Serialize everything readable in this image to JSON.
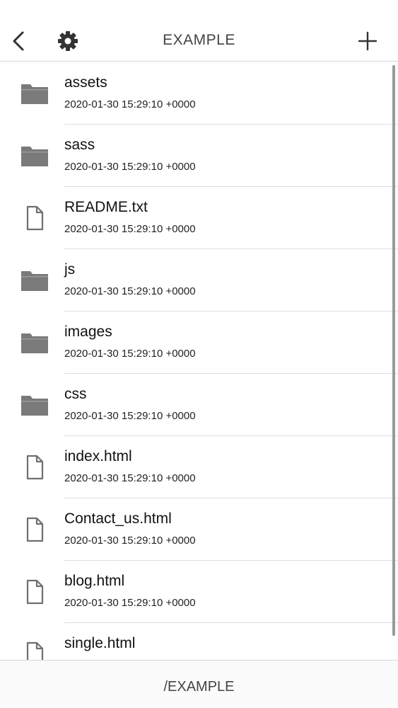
{
  "header": {
    "title": "EXAMPLE",
    "back_icon": "chevron-left-icon",
    "settings_icon": "gear-icon",
    "add_icon": "plus-icon"
  },
  "files": [
    {
      "name": "assets",
      "date": "2020-01-30 15:29:10 +0000",
      "kind": "folder"
    },
    {
      "name": "sass",
      "date": "2020-01-30 15:29:10 +0000",
      "kind": "folder"
    },
    {
      "name": "README.txt",
      "date": "2020-01-30 15:29:10 +0000",
      "kind": "file"
    },
    {
      "name": "js",
      "date": "2020-01-30 15:29:10 +0000",
      "kind": "folder"
    },
    {
      "name": "images",
      "date": "2020-01-30 15:29:10 +0000",
      "kind": "folder"
    },
    {
      "name": "css",
      "date": "2020-01-30 15:29:10 +0000",
      "kind": "folder"
    },
    {
      "name": "index.html",
      "date": "2020-01-30 15:29:10 +0000",
      "kind": "file"
    },
    {
      "name": "Contact_us.html",
      "date": "2020-01-30 15:29:10 +0000",
      "kind": "file"
    },
    {
      "name": "blog.html",
      "date": "2020-01-30 15:29:10 +0000",
      "kind": "file"
    },
    {
      "name": "single.html",
      "date": "",
      "kind": "file"
    }
  ],
  "footer": {
    "path": "/EXAMPLE"
  },
  "colors": {
    "icon_fill": "#7a7a7a",
    "icon_stroke": "#6f6f6f",
    "divider": "#dedede",
    "nav_icon": "#333333"
  }
}
